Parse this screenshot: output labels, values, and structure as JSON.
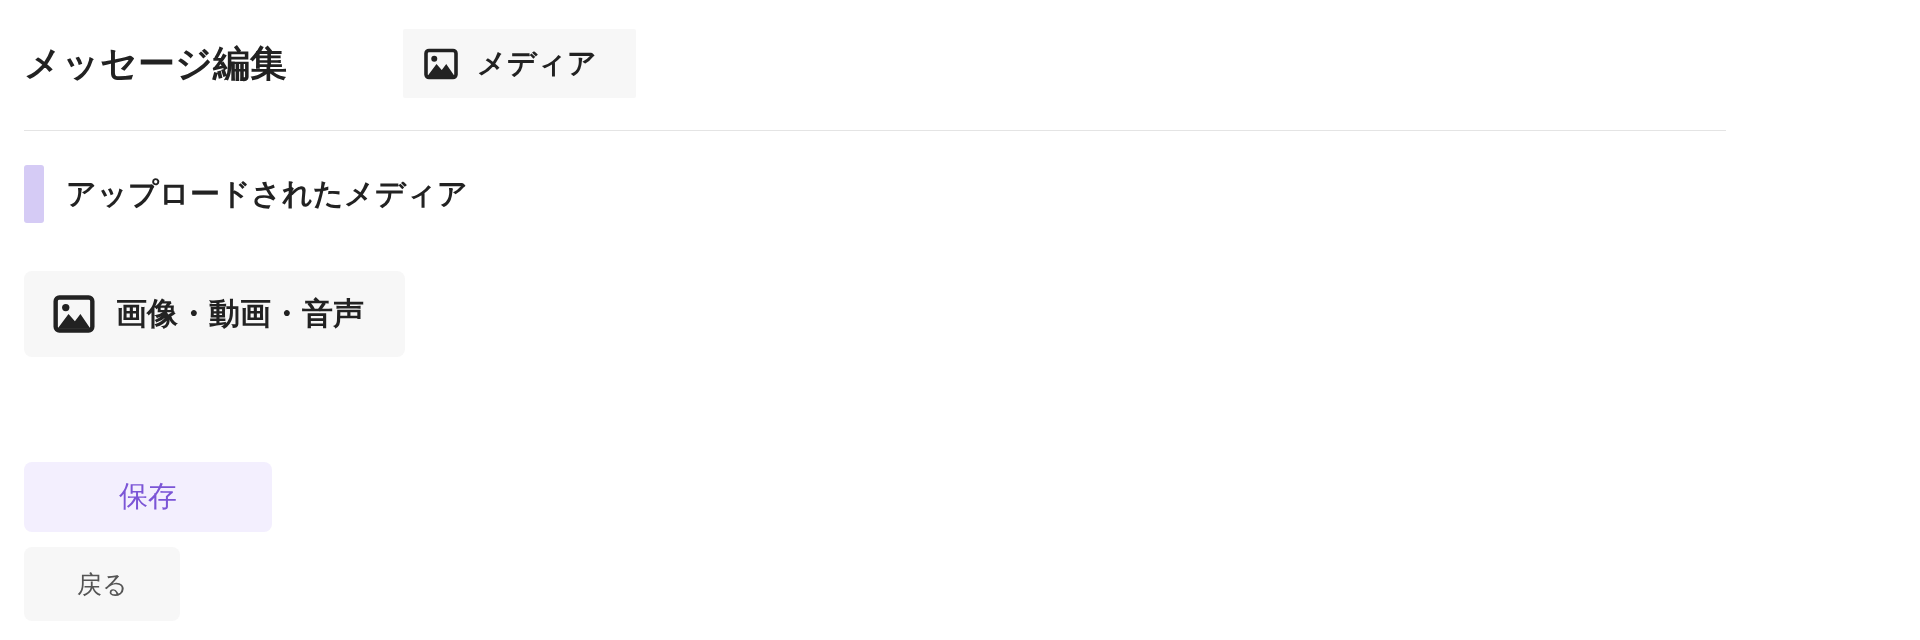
{
  "header": {
    "title": "メッセージ編集",
    "tabs": [
      {
        "label": "メディア"
      }
    ]
  },
  "section": {
    "heading": "アップロードされたメディア"
  },
  "media_button": {
    "label": "画像・動画・音声"
  },
  "actions": [
    {
      "kind": "primary",
      "label": "保存"
    },
    {
      "kind": "secondary",
      "label": "戻る"
    }
  ]
}
